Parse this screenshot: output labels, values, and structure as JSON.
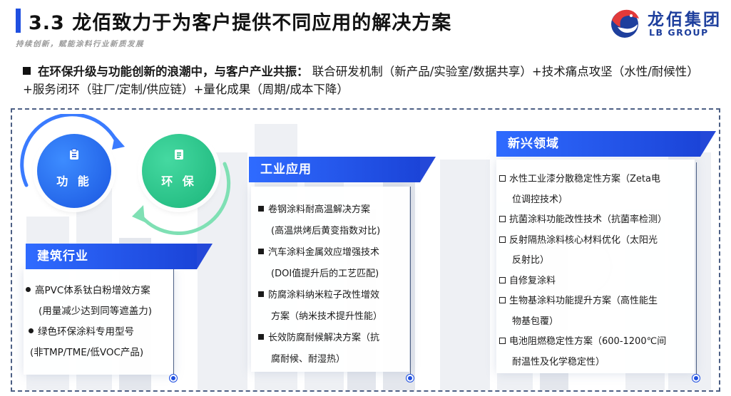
{
  "header": {
    "title": "3.3  龙佰致力于为客户提供不同应用的解决方案",
    "subtitle": "持续创新，赋能涂料行业新质发展",
    "logo_cn": "龙佰集团",
    "logo_en": "LB GROUP"
  },
  "intro": {
    "lead": "在环保升级与功能创新的浪潮中，与客户产业共振：",
    "body": "联合研发机制（新产品/实验室/数据共享）+技术痛点攻坚（水性/耐候性）+服务闭环（驻厂/定制/供应链）+量化成果（周期/成本下降）"
  },
  "circles": {
    "function_label": "功 能",
    "eco_label": "环 保"
  },
  "building": {
    "title": "建筑行业",
    "items": [
      {
        "text": "高PVC体系钛白粉增效方案",
        "note": "(用量减少达到同等遮盖力)"
      },
      {
        "text": "绿色环保涂料专用型号",
        "note": "(非TMP/TME/低VOC产品)"
      }
    ]
  },
  "industrial": {
    "title": "工业应用",
    "items": [
      {
        "text": "卷钢涂料耐高温解决方案",
        "note": "(高温烘烤后黄变指数对比)"
      },
      {
        "text": "汽车涂料金属效应增强技术",
        "note": "(DOI值提升后的工艺匹配)"
      },
      {
        "text": "防腐涂料纳米粒子改性增效",
        "note": "方案（纳米技术提升性能）"
      },
      {
        "text": "长效防腐耐候解决方案（抗",
        "note": "腐耐候、耐湿热）"
      }
    ]
  },
  "emerging": {
    "title": "新兴领域",
    "items": [
      {
        "text": "水性工业漆分散稳定性方案（Zeta电",
        "note": "位调控技术）"
      },
      {
        "text": "抗菌涂料功能改性技术（抗菌率检测）",
        "note": ""
      },
      {
        "text": "反射隔热涂料核心材料优化（太阳光",
        "note": "反射比）"
      },
      {
        "text": "自修复涂料",
        "note": ""
      },
      {
        "text": "生物基涂料功能提升方案（高性能生",
        "note": "物基包覆）"
      },
      {
        "text": "电池阻燃稳定性方案（600-1200℃间",
        "note": "耐温性及化学稳定性）"
      }
    ]
  },
  "colors": {
    "accent": "#1f4fe0",
    "green": "#1bb57a",
    "logo": "#1e3f9d"
  }
}
